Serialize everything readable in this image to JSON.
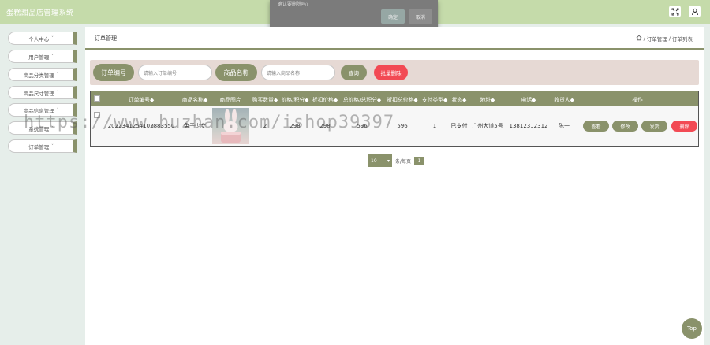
{
  "app": {
    "title": "蛋糕甜品店管理系统"
  },
  "dialog": {
    "message": "确认要删除吗?",
    "ok_label": "确定",
    "cancel_label": "取消"
  },
  "header_icons": [
    "fullscreen-icon",
    "user-icon"
  ],
  "sidebar": {
    "items": [
      {
        "label": "个人中心"
      },
      {
        "label": "用户管理"
      },
      {
        "label": "商品分类管理"
      },
      {
        "label": "商品尺寸管理"
      },
      {
        "label": "商品信息管理"
      },
      {
        "label": "系统管理"
      },
      {
        "label": "订单管理"
      }
    ],
    "arrow": "˅"
  },
  "page": {
    "title": "订单管理",
    "breadcrumb": [
      "订单管理",
      "订单列表"
    ],
    "separator": "/"
  },
  "search": {
    "order_no_label": "订单编号",
    "order_no_placeholder": "请输入订单编号",
    "product_name_label": "商品名称",
    "product_name_placeholder": "请输入商品名称",
    "query_label": "查询",
    "batch_delete_label": "批量删除"
  },
  "table": {
    "columns": [
      "订单编号◆",
      "商品名称◆",
      "商品图片",
      "购买数量◆",
      "价格/积分◆",
      "折扣价格◆",
      "总价格/总积分◆",
      "折扣总价格◆",
      "支付类型◆",
      "状态◆",
      "地址◆",
      "电话◆",
      "收货人◆",
      "操作"
    ],
    "rows": [
      {
        "order_no": "2022341254102883550",
        "product_name": "兔子少女",
        "quantity": "2",
        "price": "298",
        "discount_price": "298",
        "total": "596",
        "discount_total": "596",
        "pay_type": "1",
        "status": "已支付",
        "address": "广州大道5号",
        "phone": "13812312312",
        "receiver": "陈一"
      }
    ],
    "actions": {
      "view": "查看",
      "edit": "修改",
      "ship": "发货",
      "delete": "删除"
    }
  },
  "pagination": {
    "page_size": "10",
    "per_page_text": "条/每页",
    "current_page": "1"
  },
  "watermark": "https://www.huzhan.com/ishop39397",
  "top_button": "Top",
  "colors": {
    "accent": "#8a926b",
    "topbar": "#c5dbaa",
    "danger": "#f24a54",
    "search_bg": "#e6d9d4"
  }
}
